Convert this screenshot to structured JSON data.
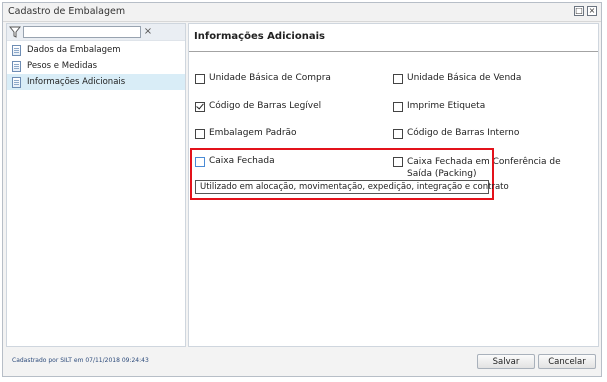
{
  "window": {
    "title": "Cadastro de Embalagem"
  },
  "filter": {
    "value": "",
    "clear_label": "×"
  },
  "nav": {
    "items": [
      {
        "label": "Dados da Embalagem",
        "selected": false
      },
      {
        "label": "Pesos e Medidas",
        "selected": false
      },
      {
        "label": "Informações Adicionais",
        "selected": true
      }
    ]
  },
  "section": {
    "title": "Informações Adicionais"
  },
  "options": [
    {
      "label": "Unidade Básica de Compra",
      "checked": false
    },
    {
      "label": "Unidade Básica de Venda",
      "checked": false
    },
    {
      "label": "Código de Barras Legível",
      "checked": true
    },
    {
      "label": "Imprime Etiqueta",
      "checked": false
    },
    {
      "label": "Embalagem Padrão",
      "checked": false
    },
    {
      "label": "Código de Barras Interno",
      "checked": false
    },
    {
      "label": "Caixa Fechada",
      "checked": false
    },
    {
      "label": "Caixa Fechada em Conferência de Saída (Packing)",
      "checked": false
    }
  ],
  "tooltip": {
    "text": "Utilizado em alocação, movimentação, expedição, integração e contrato"
  },
  "footer": {
    "status": "Cadastrado por SILT em 07/11/2018 09:24:43",
    "save_label": "Salvar",
    "cancel_label": "Cancelar"
  },
  "colors": {
    "highlight": "#e3121b",
    "selected_bg": "#d9edf7"
  }
}
